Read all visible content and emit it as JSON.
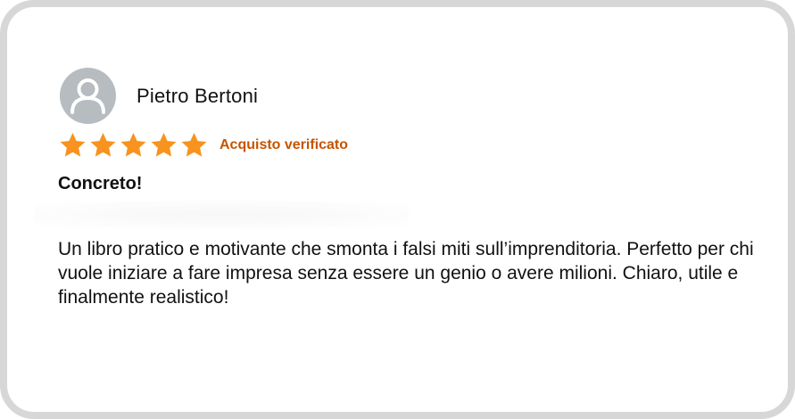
{
  "review": {
    "reviewer_name": "Pietro Bertoni",
    "avatar_icon": "user-avatar-icon",
    "rating": 5,
    "rating_max": 5,
    "star_color": "#f7931e",
    "verified_label": "Acquisto verificato",
    "verified_color": "#c45500",
    "title": "Concreto!",
    "body": "Un libro pratico e motivante che smonta i falsi miti sull’imprenditoria. Perfetto per chi vuole iniziare a fare impresa senza essere un genio o avere milioni. Chiaro, utile e finalmente realistico!"
  }
}
